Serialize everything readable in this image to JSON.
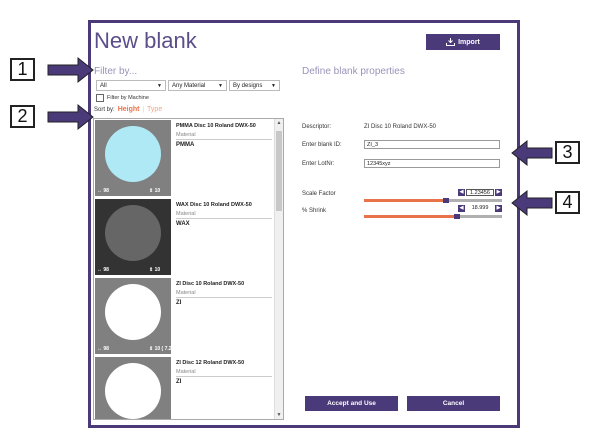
{
  "window": {
    "title": "New blank",
    "import_label": "Import"
  },
  "filter": {
    "title": "Filter by...",
    "dropdowns": [
      "All",
      "Any Material",
      "By designs"
    ],
    "filter_by_machine": "Filter by Machine",
    "sort_label": "Sort by:",
    "sort_height": "Height",
    "sort_type": "Type"
  },
  "blanks": [
    {
      "name": "PMMA Disc 10 Roland DWX-50",
      "material_label": "Material",
      "material": "PMMA",
      "diameter": "↔ 98",
      "height": "⇕ 10",
      "disc_color": "#aee9f5",
      "bg_color": "#808080"
    },
    {
      "name": "WAX Disc 10 Roland DWX-50",
      "material_label": "Material",
      "material": "WAX",
      "diameter": "↔ 98",
      "height": "⇕ 10",
      "disc_color": "#666666",
      "bg_color": "#333333"
    },
    {
      "name": "ZI Disc 10 Roland DWX-50",
      "material_label": "Material",
      "material": "ZI",
      "diameter": "↔ 98",
      "height": "⇕ 10 ( 7.2 )",
      "disc_color": "#ffffff",
      "bg_color": "#808080"
    },
    {
      "name": "ZI Disc 12 Roland DWX-50",
      "material_label": "Material",
      "material": "ZI",
      "diameter": "",
      "height": "",
      "disc_color": "#ffffff",
      "bg_color": "#808080"
    }
  ],
  "properties": {
    "title": "Define blank properties",
    "descriptor_label": "Descriptor:",
    "descriptor_value": "ZI Disc 10 Roland DWX-50",
    "blank_id_label": "Enter blank ID:",
    "blank_id_value": "ZI_3",
    "lotnr_label": "Enter LotNr:",
    "lotnr_value": "12345xyz",
    "scale_label": "Scale Factor",
    "scale_value": "1.23456",
    "scale_fraction": 0.57,
    "shrink_label": "% Shrink",
    "shrink_value": "18.999",
    "shrink_fraction": 0.65
  },
  "buttons": {
    "accept": "Accept and Use",
    "cancel": "Cancel"
  },
  "callouts": [
    "1",
    "2",
    "3",
    "4"
  ],
  "colors": {
    "accent": "#4a3a7a",
    "highlight": "#e8734a"
  }
}
